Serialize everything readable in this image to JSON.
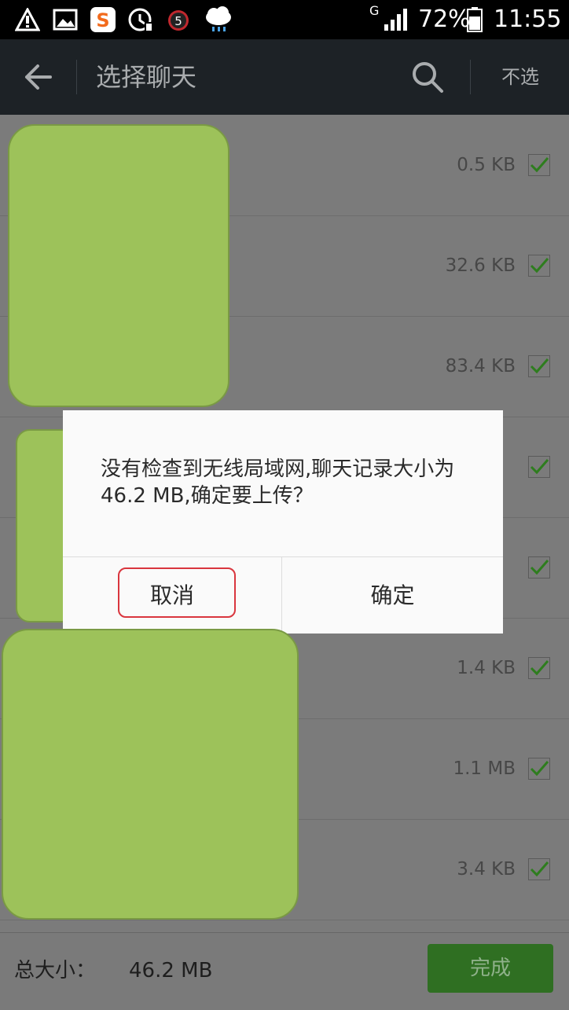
{
  "status_bar": {
    "network": "G",
    "battery": "72%",
    "time": "11:55",
    "icons": [
      "warning-usb-icon",
      "gallery-icon",
      "sogou-input-icon",
      "cleaner-icon",
      "alarm-icon",
      "weather-rain-icon",
      "signal-icon",
      "battery-icon"
    ]
  },
  "app_bar": {
    "title": "选择聊天",
    "deselect_label": "不选"
  },
  "list": {
    "rows": [
      {
        "size": "0.5 KB",
        "checked": true
      },
      {
        "size": "32.6 KB",
        "checked": true
      },
      {
        "size": "83.4 KB",
        "checked": true
      },
      {
        "size": "",
        "checked": true
      },
      {
        "size": "",
        "checked": true
      },
      {
        "size": "1.4 KB",
        "checked": true
      },
      {
        "size": "1.1 MB",
        "checked": true
      },
      {
        "size": "3.4 KB",
        "checked": true
      }
    ]
  },
  "dialog": {
    "message": "没有检查到无线局域网,聊天记录大小为46.2 MB,确定要上传？",
    "cancel_label": "取消",
    "confirm_label": "确定"
  },
  "bottom_bar": {
    "total_label": "总大小：",
    "total_value": "46.2 MB",
    "done_label": "完成"
  },
  "colors": {
    "accent_check": "#2e7d1e",
    "done_button": "#2f6f22",
    "highlight": "#d9363e"
  }
}
